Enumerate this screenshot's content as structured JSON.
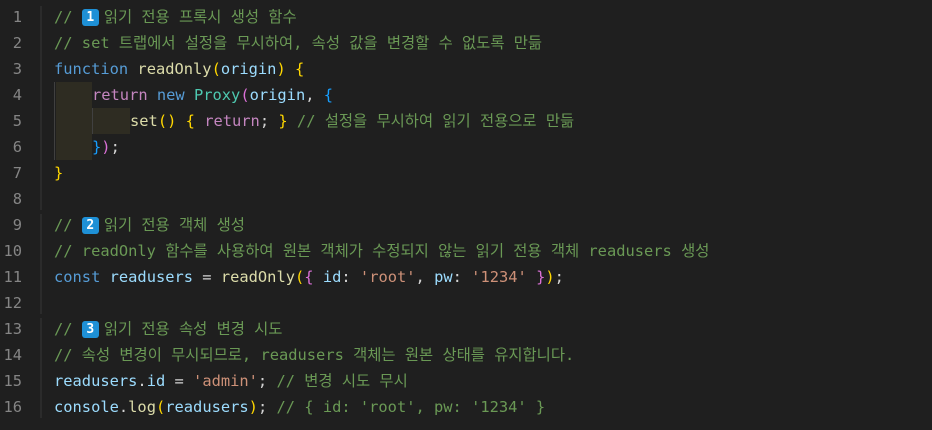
{
  "editor": {
    "lines": [
      {
        "number": "1",
        "tokens": [
          {
            "t": "// ",
            "c": "c"
          },
          {
            "t": "1",
            "c": "badge"
          },
          {
            "t": "읽기 전용 프록시 생성 함수",
            "c": "c"
          }
        ]
      },
      {
        "number": "2",
        "tokens": [
          {
            "t": "// set 트랩에서 설정을 무시하여, 속성 값을 변경할 수 없도록 만듦",
            "c": "c"
          }
        ]
      },
      {
        "number": "3",
        "tokens": [
          {
            "t": "function",
            "c": "kw"
          },
          {
            "t": " ",
            "c": "p"
          },
          {
            "t": "readOnly",
            "c": "fn"
          },
          {
            "t": "(",
            "c": "b1"
          },
          {
            "t": "origin",
            "c": "v"
          },
          {
            "t": ")",
            "c": "b1"
          },
          {
            "t": " ",
            "c": "p"
          },
          {
            "t": "{",
            "c": "b1"
          }
        ]
      },
      {
        "number": "4",
        "tokens": [
          {
            "t": "return",
            "c": "ct"
          },
          {
            "t": " ",
            "c": "p"
          },
          {
            "t": "new",
            "c": "kw"
          },
          {
            "t": " ",
            "c": "p"
          },
          {
            "t": "Proxy",
            "c": "cls"
          },
          {
            "t": "(",
            "c": "b2"
          },
          {
            "t": "origin",
            "c": "v"
          },
          {
            "t": ", ",
            "c": "p"
          },
          {
            "t": "{",
            "c": "b3"
          }
        ]
      },
      {
        "number": "5",
        "tokens": [
          {
            "t": "set",
            "c": "fn"
          },
          {
            "t": "()",
            "c": "b1"
          },
          {
            "t": " ",
            "c": "p"
          },
          {
            "t": "{",
            "c": "b1"
          },
          {
            "t": " ",
            "c": "p"
          },
          {
            "t": "return",
            "c": "ct"
          },
          {
            "t": "; ",
            "c": "p"
          },
          {
            "t": "}",
            "c": "b1"
          },
          {
            "t": " ",
            "c": "p"
          },
          {
            "t": "// 설정을 무시하여 읽기 전용으로 만듦",
            "c": "c"
          }
        ]
      },
      {
        "number": "6",
        "tokens": [
          {
            "t": "}",
            "c": "b3"
          },
          {
            "t": ")",
            "c": "b2"
          },
          {
            "t": ";",
            "c": "p"
          }
        ]
      },
      {
        "number": "7",
        "tokens": [
          {
            "t": "}",
            "c": "b1"
          }
        ]
      },
      {
        "number": "8",
        "tokens": []
      },
      {
        "number": "9",
        "tokens": [
          {
            "t": "// ",
            "c": "c"
          },
          {
            "t": "2",
            "c": "badge"
          },
          {
            "t": "읽기 전용 객체 생성",
            "c": "c"
          }
        ]
      },
      {
        "number": "10",
        "tokens": [
          {
            "t": "// readOnly 함수를 사용하여 원본 객체가 수정되지 않는 읽기 전용 객체 readusers 생성",
            "c": "c"
          }
        ]
      },
      {
        "number": "11",
        "tokens": [
          {
            "t": "const",
            "c": "kw"
          },
          {
            "t": " ",
            "c": "p"
          },
          {
            "t": "readusers",
            "c": "v"
          },
          {
            "t": " = ",
            "c": "p"
          },
          {
            "t": "readOnly",
            "c": "fn"
          },
          {
            "t": "(",
            "c": "b1"
          },
          {
            "t": "{",
            "c": "b2"
          },
          {
            "t": " ",
            "c": "p"
          },
          {
            "t": "id",
            "c": "v"
          },
          {
            "t": ": ",
            "c": "p"
          },
          {
            "t": "'root'",
            "c": "s"
          },
          {
            "t": ", ",
            "c": "p"
          },
          {
            "t": "pw",
            "c": "v"
          },
          {
            "t": ": ",
            "c": "p"
          },
          {
            "t": "'1234'",
            "c": "s"
          },
          {
            "t": " ",
            "c": "p"
          },
          {
            "t": "}",
            "c": "b2"
          },
          {
            "t": ")",
            "c": "b1"
          },
          {
            "t": ";",
            "c": "p"
          }
        ]
      },
      {
        "number": "12",
        "tokens": []
      },
      {
        "number": "13",
        "tokens": [
          {
            "t": "// ",
            "c": "c"
          },
          {
            "t": "3",
            "c": "badge"
          },
          {
            "t": "읽기 전용 속성 변경 시도",
            "c": "c"
          }
        ]
      },
      {
        "number": "14",
        "tokens": [
          {
            "t": "// 속성 변경이 무시되므로, readusers 객체는 원본 상태를 유지합니다.",
            "c": "c"
          }
        ]
      },
      {
        "number": "15",
        "tokens": [
          {
            "t": "readusers",
            "c": "v"
          },
          {
            "t": ".",
            "c": "p"
          },
          {
            "t": "id",
            "c": "v"
          },
          {
            "t": " = ",
            "c": "p"
          },
          {
            "t": "'admin'",
            "c": "s"
          },
          {
            "t": "; ",
            "c": "p"
          },
          {
            "t": "// 변경 시도 무시",
            "c": "c"
          }
        ]
      },
      {
        "number": "16",
        "tokens": [
          {
            "t": "console",
            "c": "v"
          },
          {
            "t": ".",
            "c": "p"
          },
          {
            "t": "log",
            "c": "fn"
          },
          {
            "t": "(",
            "c": "b1"
          },
          {
            "t": "readusers",
            "c": "v"
          },
          {
            "t": ")",
            "c": "b1"
          },
          {
            "t": "; ",
            "c": "p"
          },
          {
            "t": "// { id: 'root', pw: '1234' }",
            "c": "c"
          }
        ]
      }
    ]
  },
  "colors": {
    "background": "#1f1f1f",
    "comment": "#6a9955",
    "keyword": "#569cd6",
    "control": "#c586c0",
    "function": "#dcdcaa",
    "variable": "#9cdcfe",
    "class": "#4ec9b0",
    "string": "#ce9178",
    "badge": "#1e90d6"
  }
}
